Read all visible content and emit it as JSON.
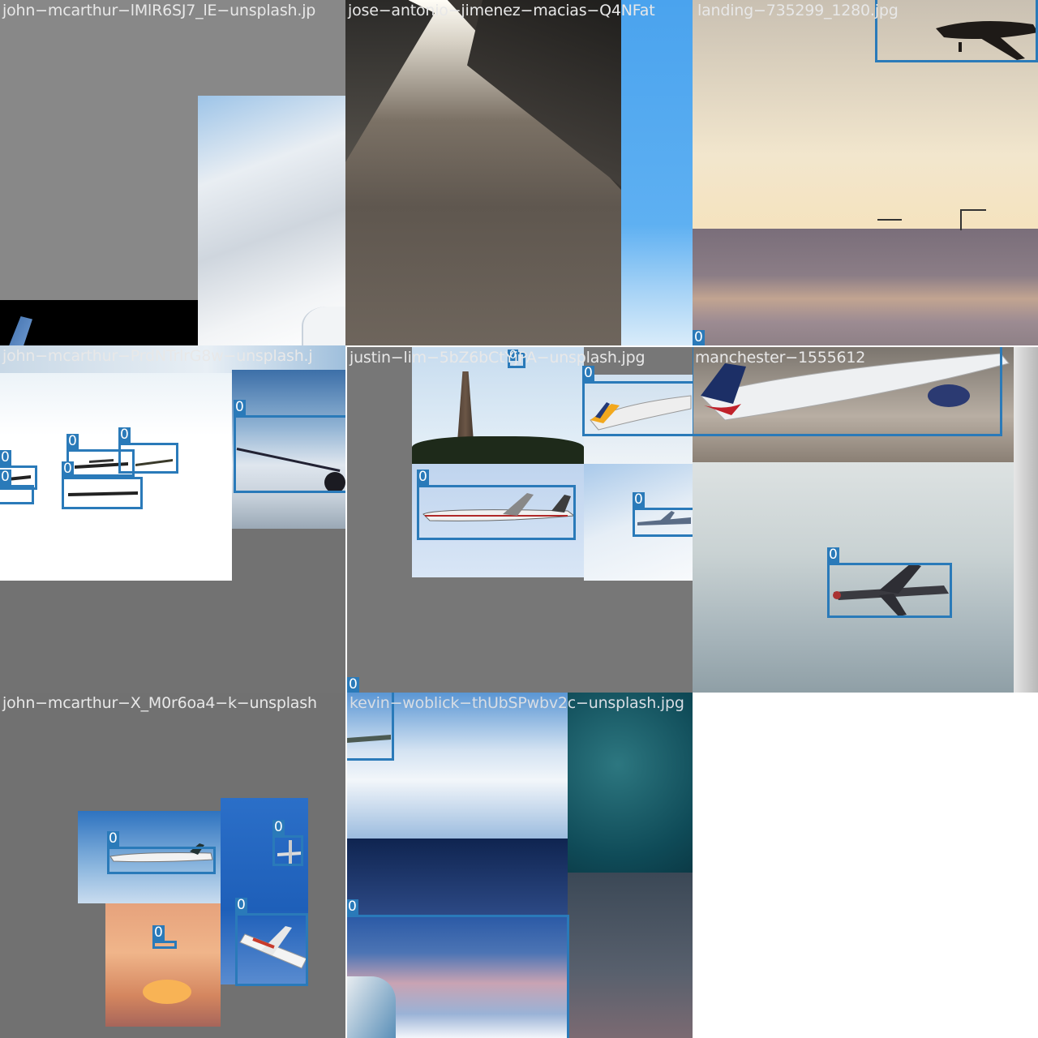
{
  "colors": {
    "box": "#2a7ab9",
    "padding_gray": "#727272",
    "caption": "#e8e8e8"
  },
  "tiles": [
    {
      "filename": "john−mcarthur−lMlR6SJ7_lE−unsplash.jp"
    },
    {
      "filename": "jose−antonio−jimenez−macias−Q4NFat"
    },
    {
      "filename": "landing−735299_1280.jpg"
    },
    {
      "filename": "john−mcarthur−PrdNTrlrG8w−unsplash.j"
    },
    {
      "filename": "justin−lim−5bZ6bCtYjPA−unsplash.jpg"
    },
    {
      "filename": "manchester−1555612"
    },
    {
      "filename": "john−mcarthur−X_M0r6oa4−k−unsplash"
    },
    {
      "filename": "kevin−woblick−thUbSPwbv2c−unsplash.jpg"
    }
  ],
  "detections": {
    "class_label": "0"
  }
}
